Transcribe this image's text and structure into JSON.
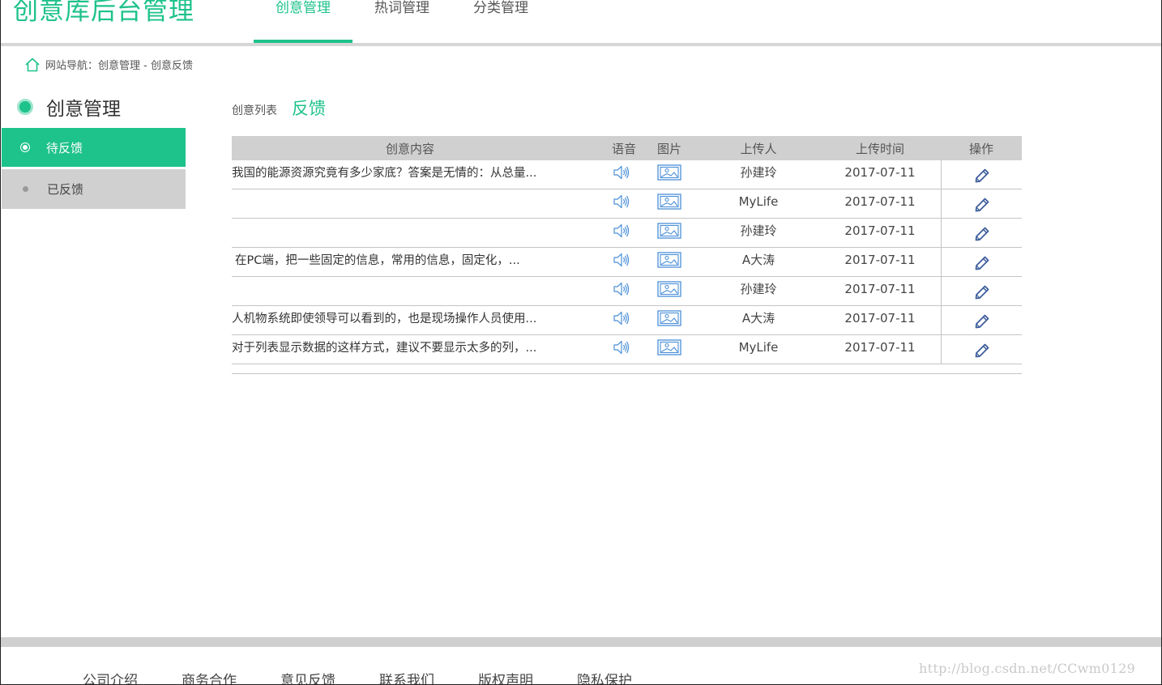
{
  "header": {
    "brand": "创意库后台管理",
    "tabs": [
      {
        "label": "创意管理",
        "active": true
      },
      {
        "label": "热词管理",
        "active": false
      },
      {
        "label": "分类管理",
        "active": false
      }
    ]
  },
  "breadcrumb": {
    "text": "网站导航：创意管理 - 创意反馈"
  },
  "sidebar": {
    "title": "创意管理",
    "items": [
      {
        "label": "待反馈",
        "active": true
      },
      {
        "label": "已反馈",
        "active": false
      }
    ]
  },
  "content": {
    "subtitle": "创意列表",
    "title": "反馈"
  },
  "table": {
    "columns": [
      "创意内容",
      "语音",
      "图片",
      "上传人",
      "上传时间",
      "操作"
    ],
    "rows": [
      {
        "content": "我国的能源资源究竟有多少家底？答案是无情的：从总量...",
        "uploader": "孙建玲",
        "time": "2017-07-11"
      },
      {
        "content": "",
        "uploader": "MyLife",
        "time": "2017-07-11"
      },
      {
        "content": "",
        "uploader": "孙建玲",
        "time": "2017-07-11"
      },
      {
        "content": " 在PC端，把一些固定的信息，常用的信息，固定化，...",
        "uploader": "A大涛",
        "time": "2017-07-11"
      },
      {
        "content": "",
        "uploader": "孙建玲",
        "time": "2017-07-11"
      },
      {
        "content": "人机物系统即使领导可以看到的，也是现场操作人员使用...",
        "uploader": "A大涛",
        "time": "2017-07-11"
      },
      {
        "content": "对于列表显示数据的这样方式，建议不要显示太多的列，...",
        "uploader": "MyLife",
        "time": "2017-07-11"
      }
    ]
  },
  "footer": {
    "links": [
      "公司介绍",
      "商务合作",
      "意见反馈",
      "联系我们",
      "版权声明",
      "隐私保护"
    ],
    "watermark": "http://blog.csdn.net/CCwm0129"
  },
  "colors": {
    "accent": "#1ec28b",
    "header_gray": "#d0d0d0",
    "icon_blue": "#4a8fd8",
    "edit_icon": "#3a5a9a"
  },
  "icons": {
    "home": "home-icon",
    "voice": "speaker-icon",
    "image": "image-icon",
    "edit": "pencil-icon"
  }
}
